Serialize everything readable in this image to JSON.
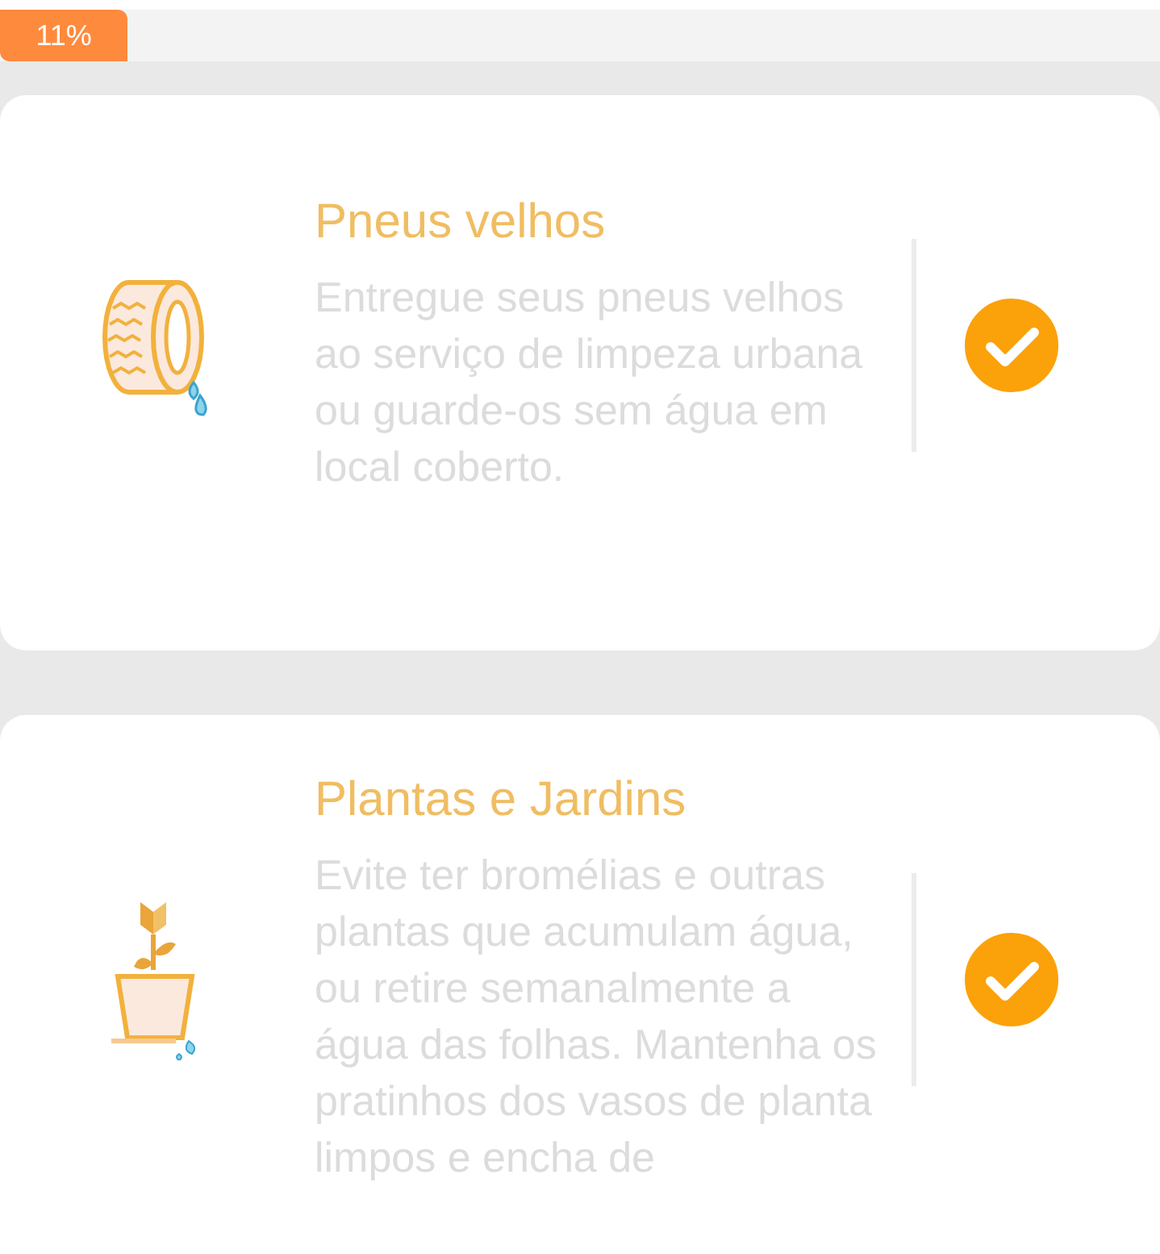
{
  "progress": {
    "level": 0.11,
    "reading": "11%"
  },
  "tips": [
    {
      "kind": "tire",
      "title": "Pneus velhos",
      "text": "Entregue seus pneus velhos ao serviço de limpeza urbana ou guarde-os sem água em local coberto.",
      "checked": true
    },
    {
      "kind": "plant",
      "title": "Plantas e Jardins",
      "text": "Evite ter bromélias e outras plantas que acumulam água, ou retire semanalmente a água das folhas. Mantenha os pratinhos dos vasos de planta limpos e encha de",
      "checked": true
    }
  ]
}
